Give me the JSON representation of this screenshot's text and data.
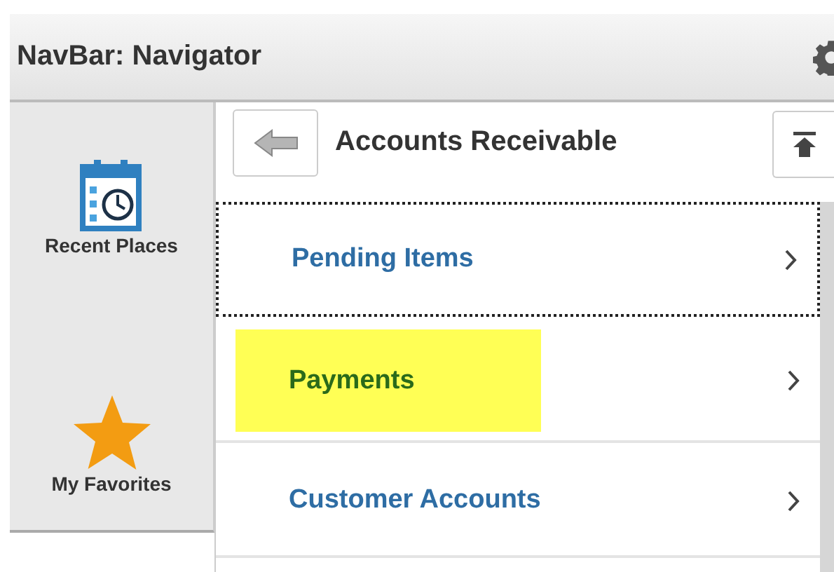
{
  "header": {
    "title": "NavBar: Navigator"
  },
  "sidebar": {
    "items": [
      {
        "label": "Recent Places",
        "kind": "recent"
      },
      {
        "label": "My Favorites",
        "kind": "favorites"
      }
    ]
  },
  "panel": {
    "title": "Accounts Receivable",
    "items": [
      {
        "label": "Pending Items",
        "focused": true,
        "highlighted": false
      },
      {
        "label": "Payments",
        "focused": false,
        "highlighted": true
      },
      {
        "label": "Customer Accounts",
        "focused": false,
        "highlighted": false
      }
    ]
  }
}
